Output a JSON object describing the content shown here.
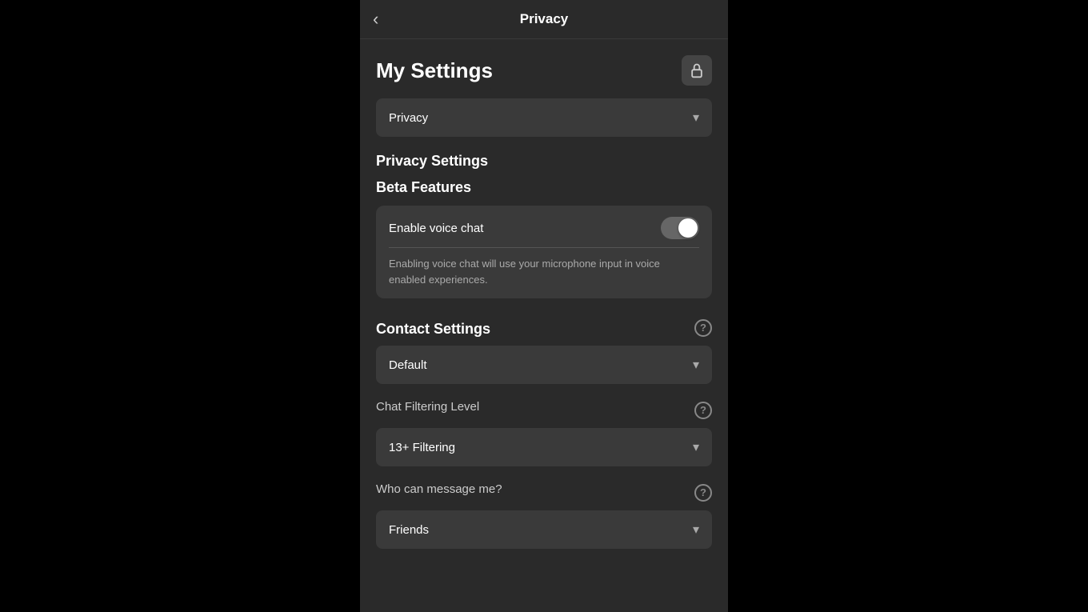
{
  "nav": {
    "title": "Privacy",
    "back_label": "‹"
  },
  "my_settings": {
    "title": "My Settings",
    "lock_icon": "lock-icon"
  },
  "category_dropdown": {
    "value": "Privacy",
    "chevron": "▾"
  },
  "privacy_settings": {
    "heading": "Privacy Settings"
  },
  "beta_features": {
    "heading": "Beta Features",
    "toggle_label": "Enable voice chat",
    "description": "Enabling voice chat will use your microphone input in voice enabled experiences.",
    "toggle_state": "on"
  },
  "contact_settings": {
    "heading": "Contact Settings",
    "help_icon": "?",
    "dropdown_value": "Default",
    "dropdown_chevron": "▾"
  },
  "chat_filtering": {
    "label": "Chat Filtering Level",
    "help_icon": "?",
    "dropdown_value": "13+ Filtering",
    "dropdown_chevron": "▾"
  },
  "who_can_message": {
    "label": "Who can message me?",
    "help_icon": "?",
    "dropdown_value": "Friends",
    "dropdown_chevron": "▾"
  }
}
